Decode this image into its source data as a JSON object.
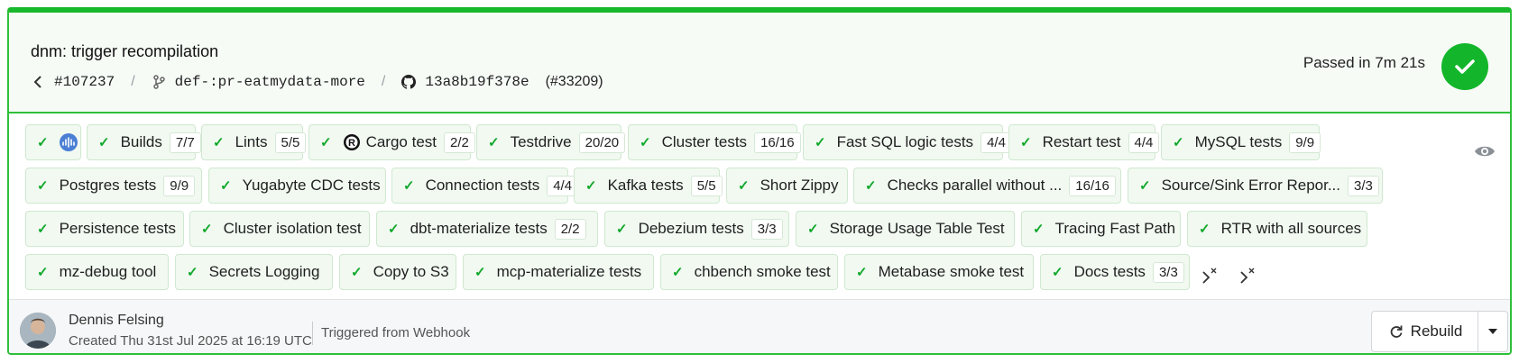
{
  "build": {
    "title": "dnm: trigger recompilation",
    "number": "#107237",
    "branch": "def-:pr-eatmydata-more",
    "commit": "13a8b19f378e",
    "pr": "(#33209)",
    "status_text": "Passed in 7m 21s",
    "status_color": "#13b62b"
  },
  "jobs": {
    "row1": [
      {
        "label": "",
        "icon": "waveform-logo-icon"
      },
      {
        "label": "Builds",
        "count": "7/7"
      },
      {
        "label": "Lints",
        "count": "5/5"
      },
      {
        "label": "Cargo test",
        "count": "2/2",
        "icon": "rust-logo-icon"
      },
      {
        "label": "Testdrive",
        "count": "20/20"
      },
      {
        "label": "Cluster tests",
        "count": "16/16"
      },
      {
        "label": "Fast SQL logic tests",
        "count": "4/4"
      },
      {
        "label": "Restart test",
        "count": "4/4"
      },
      {
        "label": "MySQL tests",
        "count": "9/9"
      }
    ],
    "row2": [
      {
        "label": "Postgres tests",
        "count": "9/9"
      },
      {
        "label": "Yugabyte CDC tests"
      },
      {
        "label": "Connection tests",
        "count": "4/4"
      },
      {
        "label": "Kafka tests",
        "count": "5/5"
      },
      {
        "label": "Short Zippy"
      },
      {
        "label": "Checks parallel without ...",
        "count": "16/16"
      },
      {
        "label": "Source/Sink Error Repor...",
        "count": "3/3"
      }
    ],
    "row3": [
      {
        "label": "Persistence tests"
      },
      {
        "label": "Cluster isolation test"
      },
      {
        "label": "dbt-materialize tests",
        "count": "2/2"
      },
      {
        "label": "Debezium tests",
        "count": "3/3"
      },
      {
        "label": "Storage Usage Table Test"
      },
      {
        "label": "Tracing Fast Path"
      },
      {
        "label": "RTR with all sources"
      }
    ],
    "row4": [
      {
        "label": "mz-debug tool"
      },
      {
        "label": "Secrets Logging"
      },
      {
        "label": "Copy to S3"
      },
      {
        "label": "mcp-materialize tests"
      },
      {
        "label": "chbench smoke test"
      },
      {
        "label": "Metabase smoke test"
      },
      {
        "label": "Docs tests",
        "count": "3/3"
      }
    ]
  },
  "footer": {
    "author": "Dennis Felsing",
    "created": "Created Thu 31st Jul 2025 at 16:19 UTC",
    "trigger": "Triggered from Webhook",
    "rebuild_label": "Rebuild"
  },
  "icons": {
    "check": "✓",
    "back": "chevron-left-icon",
    "branch": "git-branch-icon",
    "github": "github-icon",
    "eye": "eye-icon",
    "collapse": "collapse-icon",
    "refresh": "refresh-icon",
    "caret": "caret-down-icon"
  }
}
